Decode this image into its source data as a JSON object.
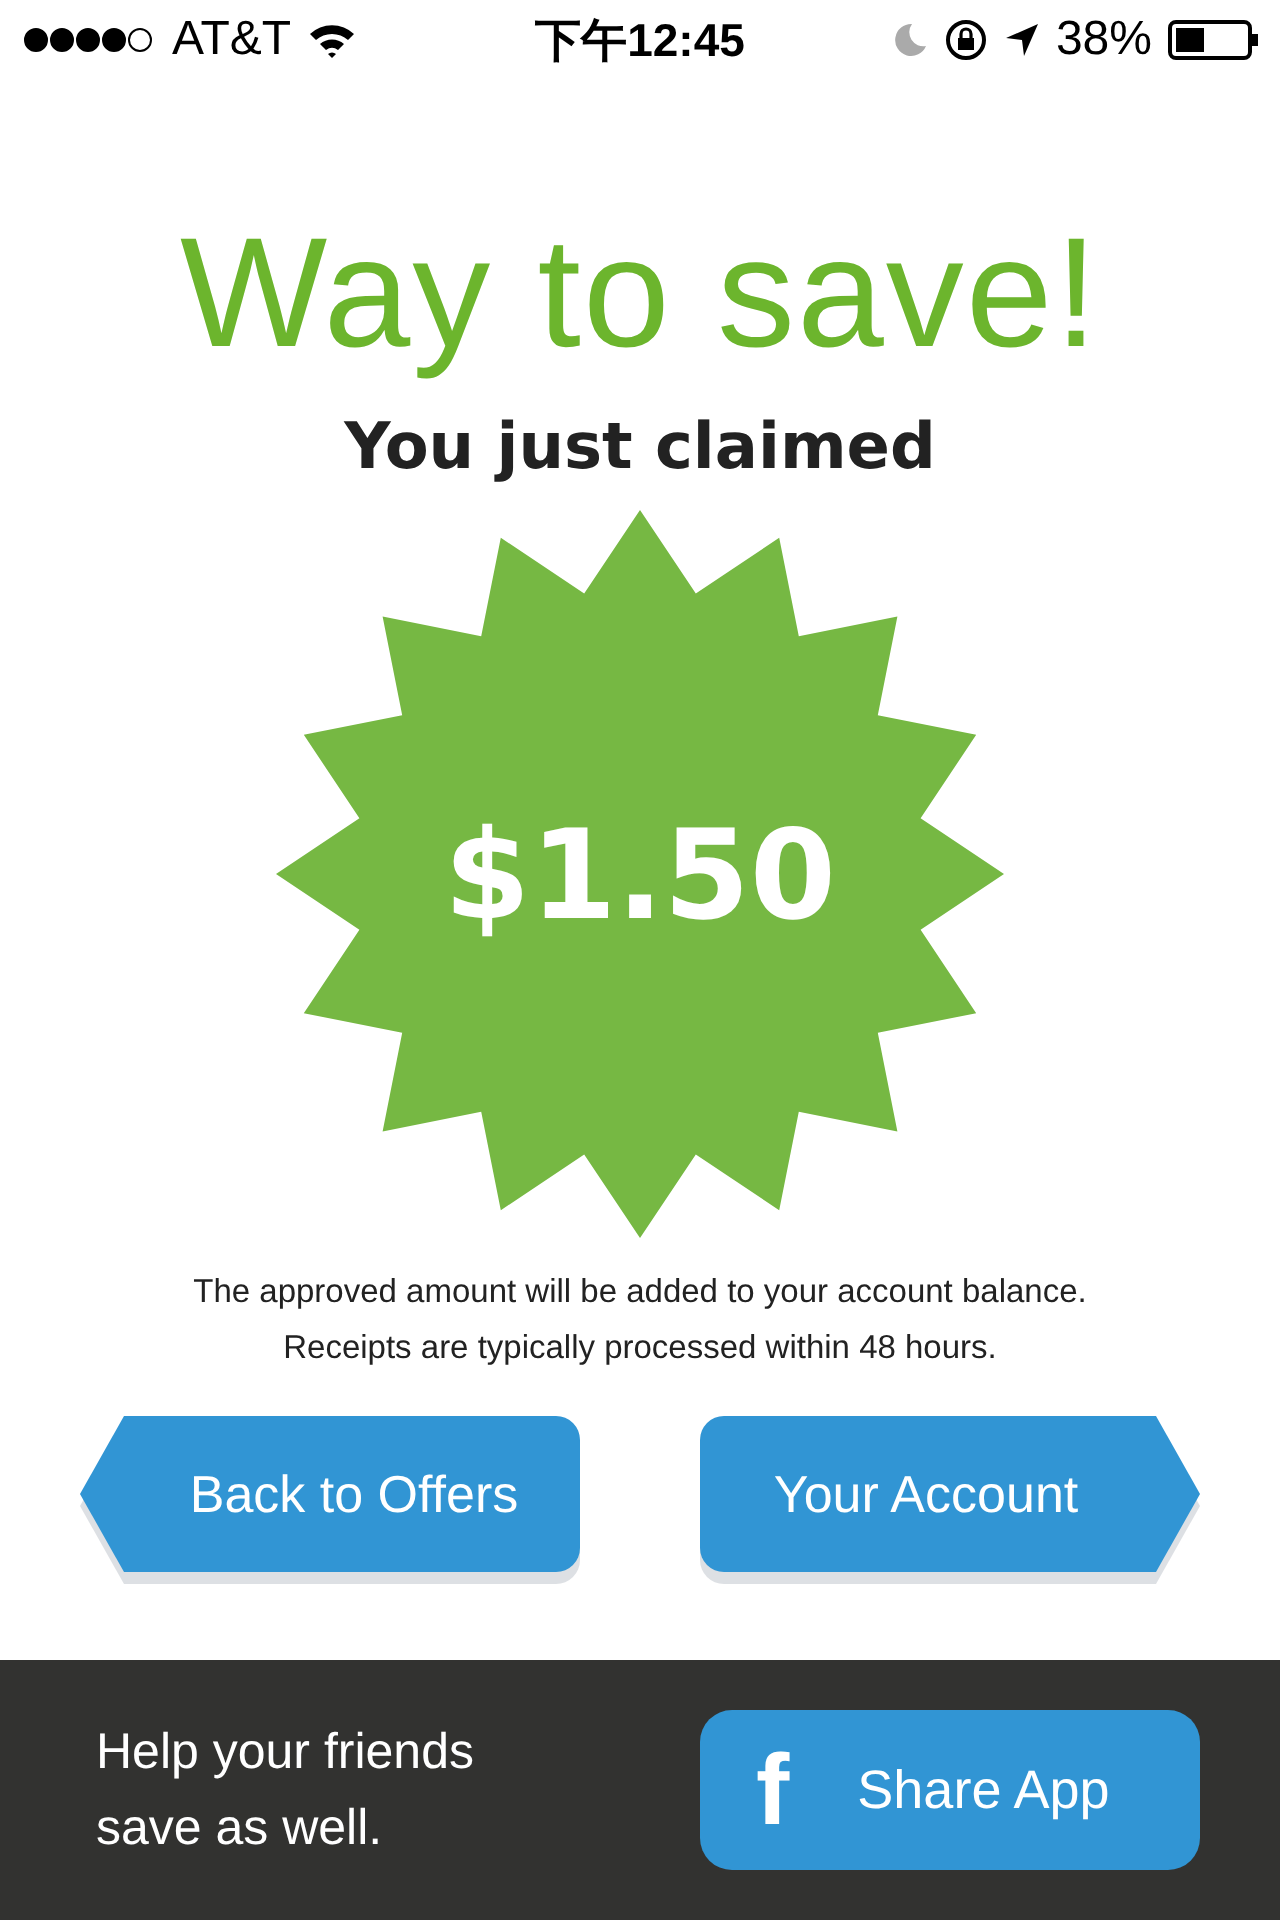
{
  "status_bar": {
    "carrier": "AT&T",
    "time": "下午12:45",
    "battery": "38%"
  },
  "title": "Way to save!",
  "subtitle": "You just claimed",
  "amount": "$1.50",
  "note": [
    "The approved amount will be added to your account balance.",
    "Receipts are typically processed within 48 hours."
  ],
  "buttons": [
    {
      "label": "Back to Offers",
      "kind": "back"
    },
    {
      "label": "Your Account",
      "kind": "forward"
    }
  ],
  "footer": {
    "text": "Help your friends save as well.",
    "share_button": {
      "icon": "f",
      "label": "Share App"
    }
  }
}
